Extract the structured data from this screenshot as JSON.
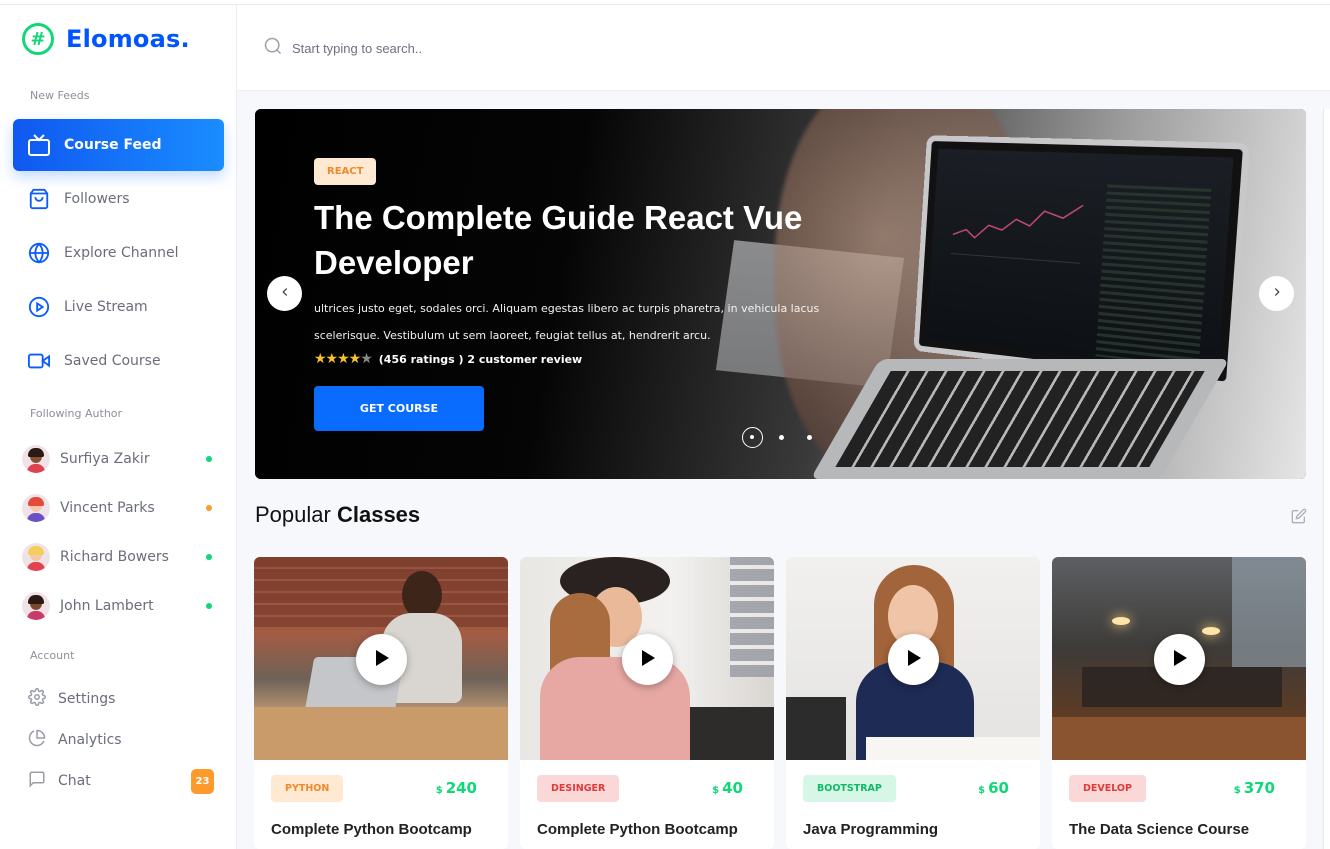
{
  "app": {
    "logo_text": "Elomoas.",
    "logo_glyph": "#"
  },
  "search": {
    "placeholder": "Start typing to search.."
  },
  "sidebar": {
    "section_feeds": "New Feeds",
    "feeds": [
      {
        "label": "Course Feed",
        "icon": "tv-icon",
        "active": true
      },
      {
        "label": "Followers",
        "icon": "shopping-bag-icon"
      },
      {
        "label": "Explore Channel",
        "icon": "globe-icon"
      },
      {
        "label": "Live Stream",
        "icon": "play-circle-icon"
      },
      {
        "label": "Saved Course",
        "icon": "video-camera-icon"
      }
    ],
    "section_authors": "Following Author",
    "authors": [
      {
        "name": "Surfiya Zakir",
        "status_color": "#10d876"
      },
      {
        "name": "Vincent Parks",
        "status_color": "#fd9a2c"
      },
      {
        "name": "Richard Bowers",
        "status_color": "#10d876"
      },
      {
        "name": "John Lambert",
        "status_color": "#10d876"
      }
    ],
    "section_account": "Account",
    "account": [
      {
        "label": "Settings",
        "icon": "gear-icon"
      },
      {
        "label": "Analytics",
        "icon": "pie-chart-icon"
      },
      {
        "label": "Chat",
        "icon": "chat-icon",
        "badge": "23"
      }
    ]
  },
  "banner": {
    "tag": "REACT",
    "title": "The Complete Guide React Vue Developer",
    "description": "ultrices justo eget, sodales orci. Aliquam egestas libero ac turpis pharetra, in vehicula lacus scelerisque. Vestibulum ut sem laoreet, feugiat tellus at, hendrerit arcu.",
    "rating_stars": 4,
    "rating_text": "(456 ratings ) 2 customer review",
    "button": "GET COURSE",
    "slide_count": 3,
    "active_slide": 1
  },
  "popular": {
    "title_light": "Popular",
    "title_bold": "Classes",
    "cards": [
      {
        "category": "PYTHON",
        "currency": "$",
        "price": "240",
        "title": "Complete Python Bootcamp",
        "cat_bg": "#ffe9d2",
        "cat_color": "#f08a28"
      },
      {
        "category": "DESINGER",
        "currency": "$",
        "price": "40",
        "title": "Complete Python Bootcamp",
        "cat_bg": "#fbd8d8",
        "cat_color": "#e03a3a"
      },
      {
        "category": "BOOTSTRAP",
        "currency": "$",
        "price": "60",
        "title": "Java Programming",
        "cat_bg": "#d6f7e6",
        "cat_color": "#10b968"
      },
      {
        "category": "DEVELOP",
        "currency": "$",
        "price": "370",
        "title": "The Data Science Course",
        "cat_bg": "#fbd8d8",
        "cat_color": "#e03a3a"
      }
    ]
  },
  "colors": {
    "primary": "#0055ff",
    "accent_green": "#10d876",
    "accent_orange": "#fd9a2c"
  }
}
